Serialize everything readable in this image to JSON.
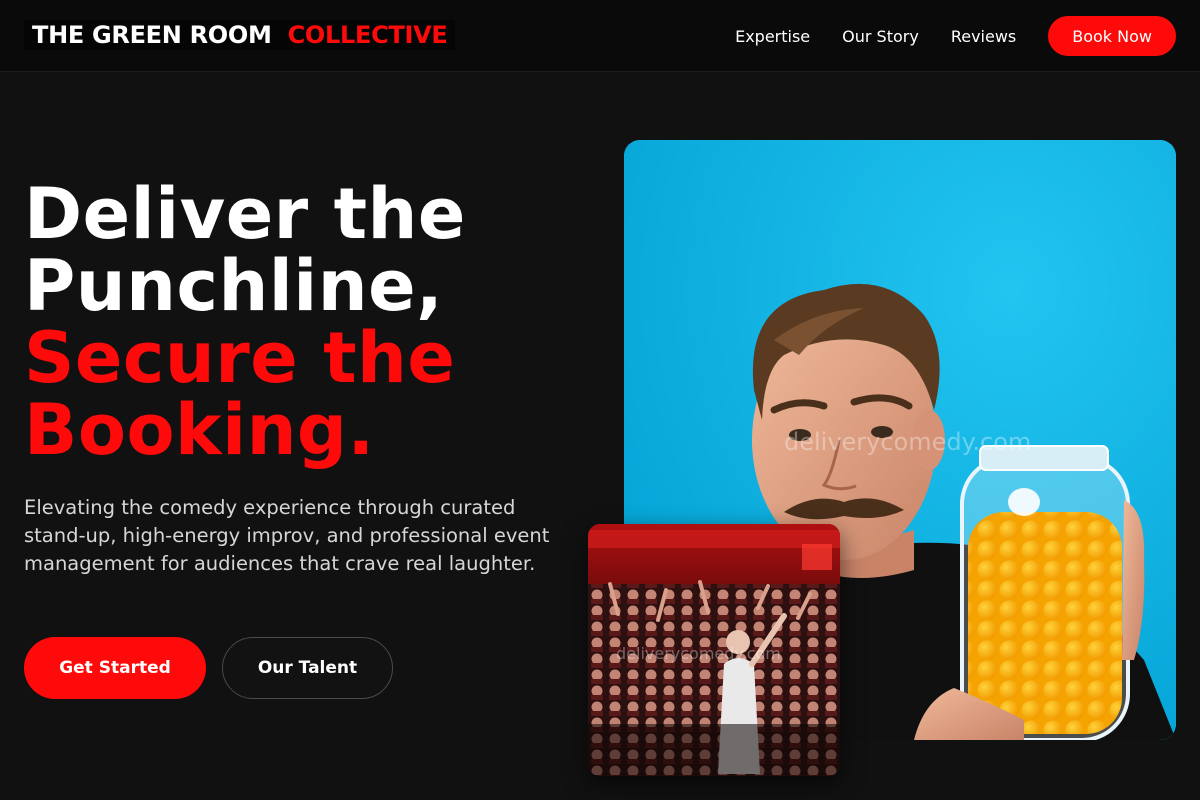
{
  "header": {
    "brand_primary": "THE GREEN ROOM",
    "brand_accent": "COLLECTIVE",
    "nav": [
      {
        "label": "Expertise"
      },
      {
        "label": "Our Story"
      },
      {
        "label": "Reviews"
      }
    ],
    "cta_label": "Book Now"
  },
  "hero": {
    "title_lines": [
      "Deliver the",
      "Punchline,",
      "Secure the",
      "Booking."
    ],
    "description": "Elevating the comedy experience through curated stand-up, high-energy improv, and professional event management for audiences that crave real laughter.",
    "primary_button": "Get Started",
    "secondary_button": "Our Talent"
  },
  "images": {
    "main_watermark": "deliverycomedy.com",
    "small_watermark": "deliverycomedy.com"
  },
  "colors": {
    "accent": "#ff0a0a",
    "background": "#111112",
    "photo_backdrop": "#0ab4e6"
  }
}
